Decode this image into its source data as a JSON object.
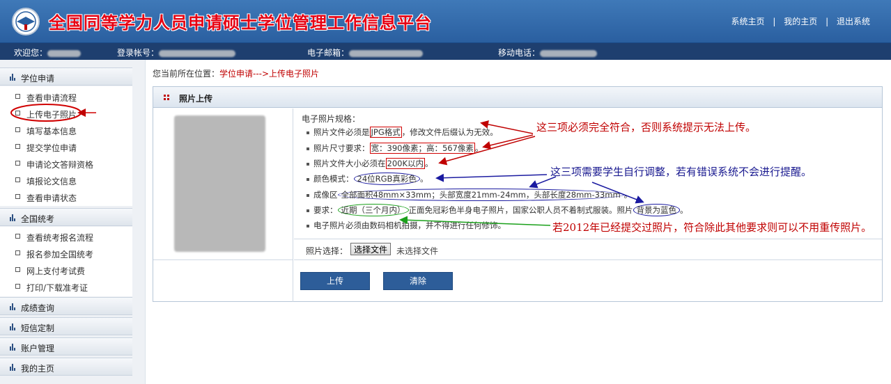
{
  "header": {
    "title": "全国同等学力人员申请硕士学位管理工作信息平台",
    "links": [
      "系统主页",
      "我的主页",
      "退出系统"
    ],
    "link_separator": "|"
  },
  "userbar": {
    "welcome_label": "欢迎您：",
    "account_label": "登录帐号：",
    "email_label": "电子邮箱：",
    "phone_label": "移动电话："
  },
  "sidebar": {
    "groups": [
      {
        "label": "学位申请",
        "items": [
          "查看申请流程",
          "上传电子照片",
          "填写基本信息",
          "提交学位申请",
          "申请论文答辩资格",
          "填报论文信息",
          "查看申请状态"
        ]
      },
      {
        "label": "全国统考",
        "items": [
          "查看统考报名流程",
          "报名参加全国统考",
          "网上支付考试费",
          "打印/下载准考证"
        ]
      },
      {
        "label": "成绩查询",
        "items": []
      },
      {
        "label": "短信定制",
        "items": []
      },
      {
        "label": "账户管理",
        "items": []
      },
      {
        "label": "我的主页",
        "items": []
      }
    ],
    "active_item": "上传电子照片"
  },
  "breadcrumb": {
    "prefix": "您当前所在位置：",
    "path": "学位申请--->上传电子照片"
  },
  "panel": {
    "title": "照片上传",
    "specs_title": "电子照片规格：",
    "specs": [
      {
        "pre": "照片文件必须是",
        "hl": "JPG格式",
        "post": "，修改文件后缀认为无效。"
      },
      {
        "pre": "照片尺寸要求：",
        "hl": "宽：390像素；高：567像素",
        "post": "。"
      },
      {
        "pre": "照片文件大小必须在",
        "hl": "200K以内",
        "post": "。"
      },
      {
        "pre": "颜色模式：",
        "hl": "24位RGB真彩色",
        "post": "。"
      },
      {
        "pre": "成像区",
        "hl": "全部面积48mm×33mm；头部宽度21mm-24mm，头部长度28mm-33mm",
        "post": "。"
      },
      {
        "pre": "要求：",
        "hl": "近期（三个月内）",
        "mid": "正面免冠彩色半身电子照片，国家公职人员不着制式服装。照片",
        "hl2": "背景为蓝色",
        "post": "。"
      },
      {
        "pre": "电子照片必须由数码相机拍摄，并不得进行任何修饰。",
        "hl": "",
        "post": ""
      }
    ],
    "file_select_label": "照片选择：",
    "file_button_label": "选择文件",
    "file_status": "未选择文件",
    "upload_button": "上传",
    "clear_button": "清除"
  },
  "annotations": {
    "red_note": "这三项必须完全符合，否则系统提示无法上传。",
    "blue_note": "这三项需要学生自行调整，若有错误系统不会进行提醒。",
    "green_note": "若2012年已经提交过照片，符合除此其他要求则可以不用重传照片。",
    "colors": {
      "red": "#c00000",
      "blue": "#1a1a90",
      "green": "#1aa01a"
    }
  }
}
